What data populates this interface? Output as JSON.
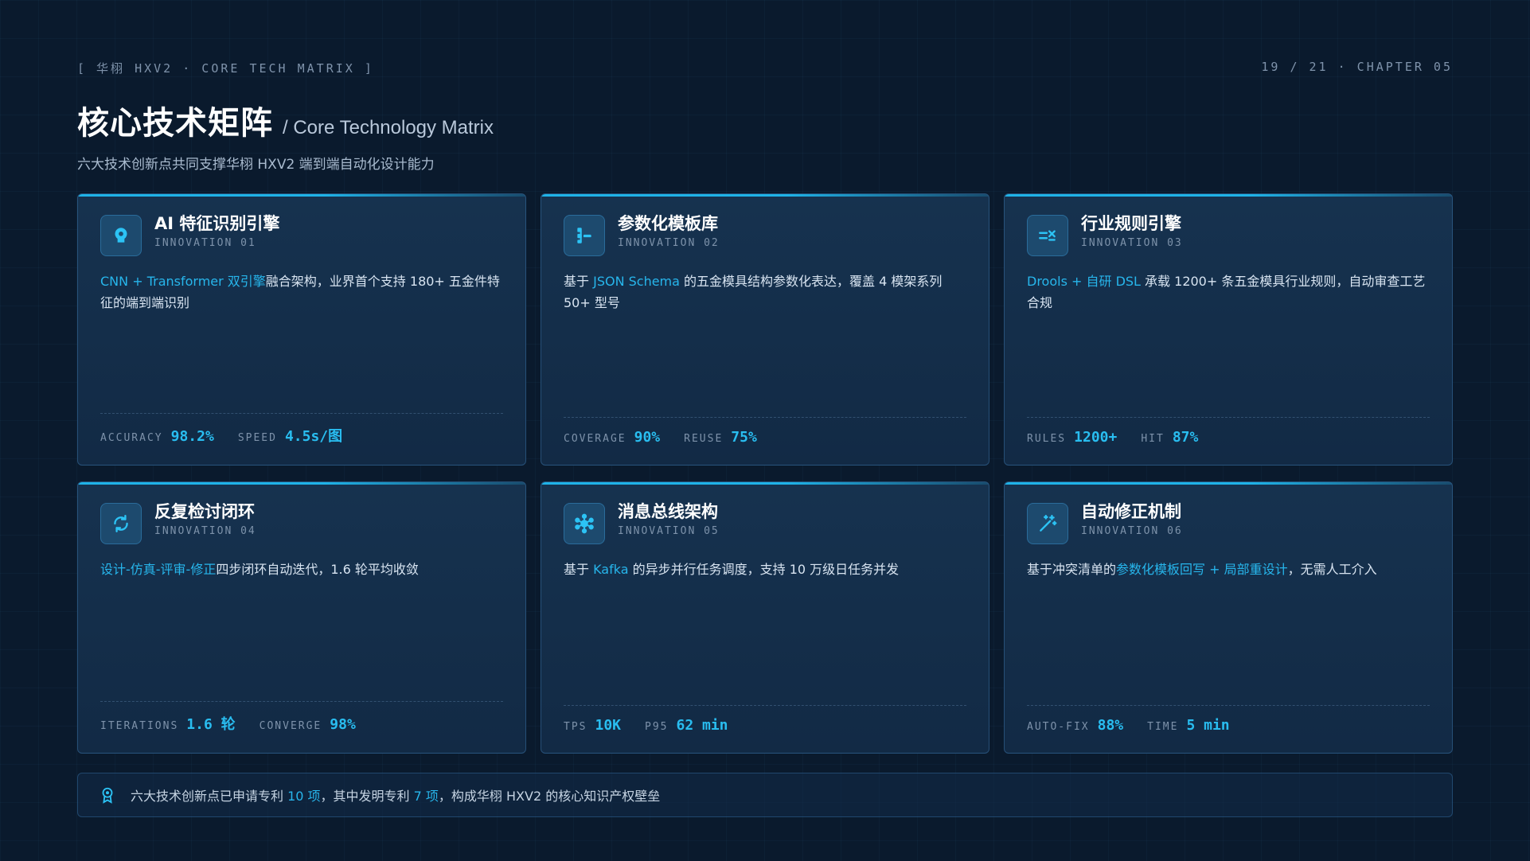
{
  "header": {
    "left_tag": "[ 华栩 HXV2 · CORE TECH MATRIX ]",
    "right_tag": "19 / 21 · CHAPTER 05",
    "title_cn": "核心技术矩阵",
    "title_en": "/ Core Technology Matrix",
    "subtitle": "六大技术创新点共同支撑华栩 HXV2 端到端自动化设计能力"
  },
  "colors": {
    "accent": "#27b6ec",
    "background": "#0a1a2d",
    "card": "#16324f"
  },
  "cards": [
    {
      "icon": "brain-icon",
      "title": "AI 特征识别引擎",
      "tag": "INNOVATION 01",
      "desc_hl": "CNN + Transformer 双引擎",
      "desc_rest": "融合架构，业界首个支持 180+ 五金件特征的端到端识别",
      "m1_label": "ACCURACY",
      "m1_value": "98.2%",
      "m2_label": "SPEED",
      "m2_value": "4.5s/图"
    },
    {
      "icon": "template-tree-icon",
      "title": "参数化模板库",
      "tag": "INNOVATION 02",
      "desc_pre": "基于 ",
      "desc_hl": "JSON Schema",
      "desc_rest": " 的五金模具结构参数化表达，覆盖 4 模架系列 50+ 型号",
      "m1_label": "COVERAGE",
      "m1_value": "90%",
      "m2_label": "REUSE",
      "m2_value": "75%"
    },
    {
      "icon": "rules-check-icon",
      "title": "行业规则引擎",
      "tag": "INNOVATION 03",
      "desc_hl": "Drools + 自研 DSL",
      "desc_rest": " 承载 1200+ 条五金模具行业规则，自动审查工艺合规",
      "m1_label": "RULES",
      "m1_value": "1200+",
      "m2_label": "HIT",
      "m2_value": "87%"
    },
    {
      "icon": "loop-arrows-icon",
      "title": "反复检讨闭环",
      "tag": "INNOVATION 04",
      "desc_hl": "设计-仿真-评审-修正",
      "desc_rest": "四步闭环自动迭代，1.6 轮平均收敛",
      "m1_label": "ITERATIONS",
      "m1_value": "1.6 轮",
      "m2_label": "CONVERGE",
      "m2_value": "98%"
    },
    {
      "icon": "network-hub-icon",
      "title": "消息总线架构",
      "tag": "INNOVATION 05",
      "desc_pre": "基于 ",
      "desc_hl": "Kafka",
      "desc_rest": " 的异步并行任务调度，支持 10 万级日任务并发",
      "m1_label": "TPS",
      "m1_value": "10K",
      "m2_label": "P95",
      "m2_value": "62 min"
    },
    {
      "icon": "magic-wand-icon",
      "title": "自动修正机制",
      "tag": "INNOVATION 06",
      "desc_pre": "基于冲突清单的",
      "desc_hl": "参数化模板回写 + 局部重设计",
      "desc_rest": "，无需人工介入",
      "m1_label": "AUTO-FIX",
      "m1_value": "88%",
      "m2_label": "TIME",
      "m2_value": "5 min"
    }
  ],
  "footer": {
    "icon": "award-icon",
    "part1": "六大技术创新点已申请专利 ",
    "hl1": "10 项",
    "part2": "，其中发明专利 ",
    "hl2": "7 项",
    "part3": "，构成华栩 HXV2 的核心知识产权壁垒"
  }
}
